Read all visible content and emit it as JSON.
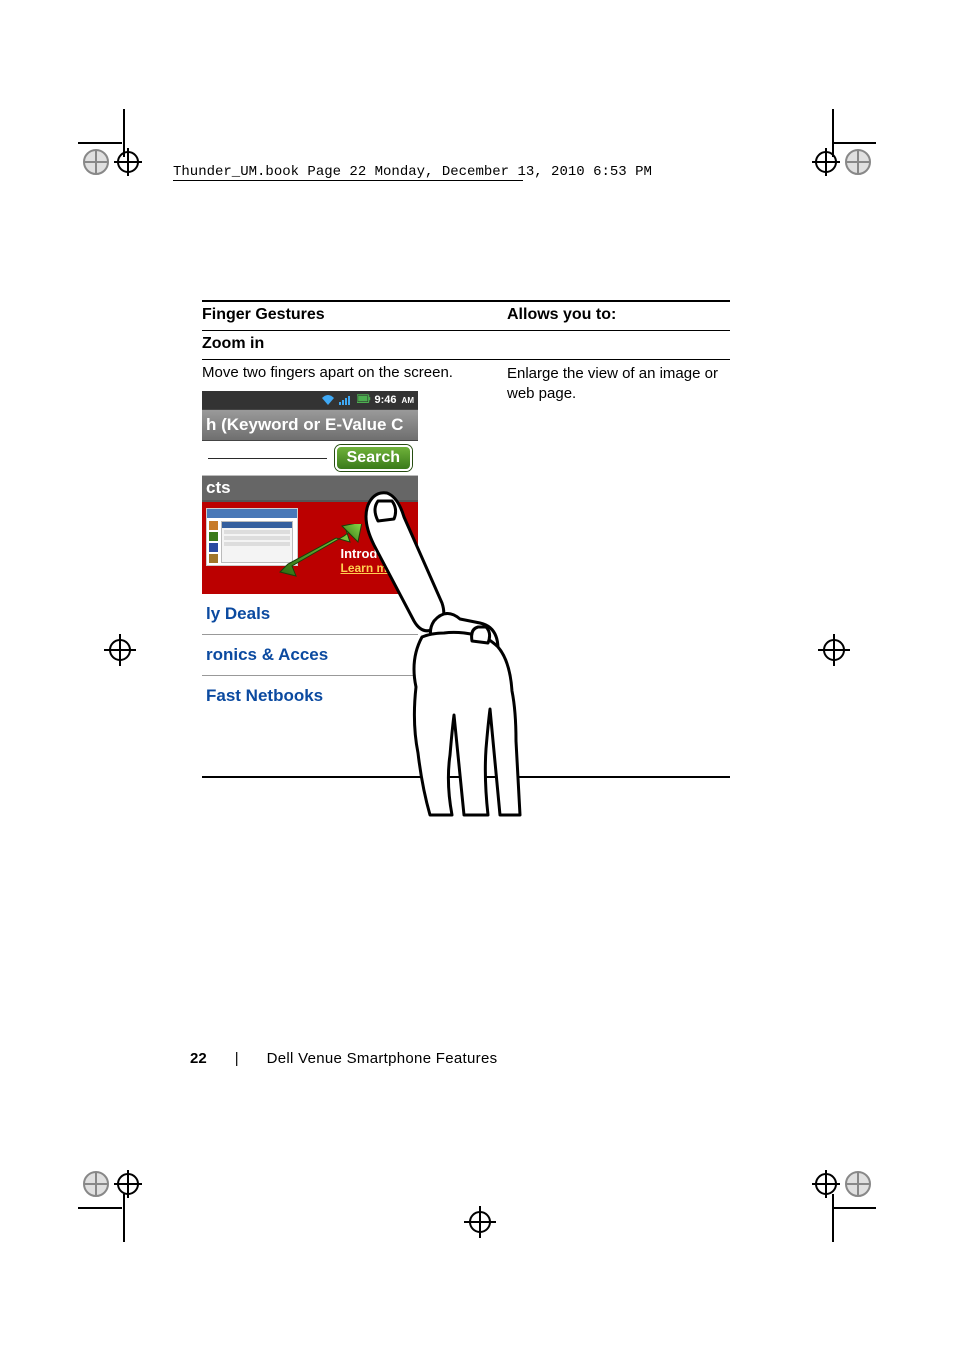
{
  "running_head": "Thunder_UM.book  Page 22  Monday, December 13, 2010  6:53 PM",
  "table": {
    "header_left": "Finger Gestures",
    "header_right": "Allows you to:",
    "section_title": "Zoom in",
    "instruction": "Move two fingers apart on the screen.",
    "result": "Enlarge the view of an image or web page."
  },
  "illustration": {
    "status_time": "9:46",
    "status_ampm": "AM",
    "grey_band_text": "h (Keyword or E-Value C",
    "search_button": "Search",
    "cts_text": "cts",
    "ad_line1": "Introducing",
    "ad_learn_more": "Learn more",
    "link_deals": "ly Deals",
    "link_electronics": "ronics & Acces",
    "link_netbooks": "Fast Netbooks"
  },
  "footer": {
    "page_number": "22",
    "separator": "|",
    "chapter_title": "Dell Venue Smartphone Features"
  }
}
